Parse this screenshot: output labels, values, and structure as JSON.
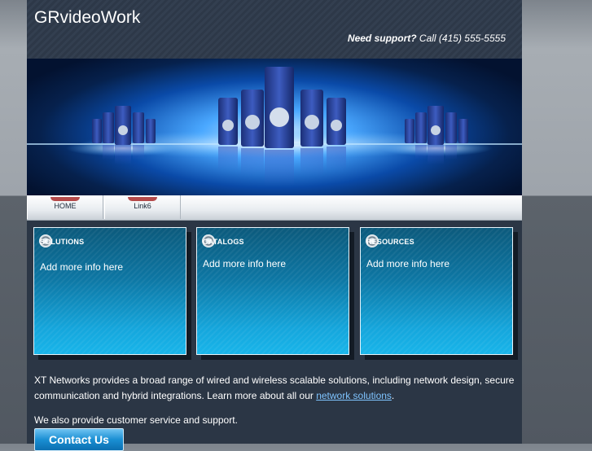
{
  "header": {
    "title": "GRvideoWork",
    "support_label": "Need support?",
    "support_text": "Call (415) 555-5555"
  },
  "nav": {
    "items": [
      {
        "label": "HOME"
      },
      {
        "label": "Link6"
      }
    ]
  },
  "boxes": [
    {
      "title": "SOLUTIONS",
      "text": "Add more info here"
    },
    {
      "title": "CATALOGS",
      "text": "Add more info here"
    },
    {
      "title": "RESOURCES",
      "text": "Add more info here"
    }
  ],
  "content": {
    "paragraph1_before": "XT Networks provides a broad range of wired and wireless scalable solutions, including network design, secure communication and hybrid integrations. Learn more about all our ",
    "paragraph1_link": "network solutions",
    "paragraph1_after": ".",
    "paragraph2": "We also provide customer service and support.",
    "button_label": "Contact Us"
  },
  "colors": {
    "page_bg": "#2b3645",
    "box_top": "#0c5a7c",
    "box_bottom": "#18b5ea",
    "link": "#7fc4ff",
    "tab_marker": "#b44a4a"
  },
  "icons": {
    "box_icon": "disc-icon"
  }
}
